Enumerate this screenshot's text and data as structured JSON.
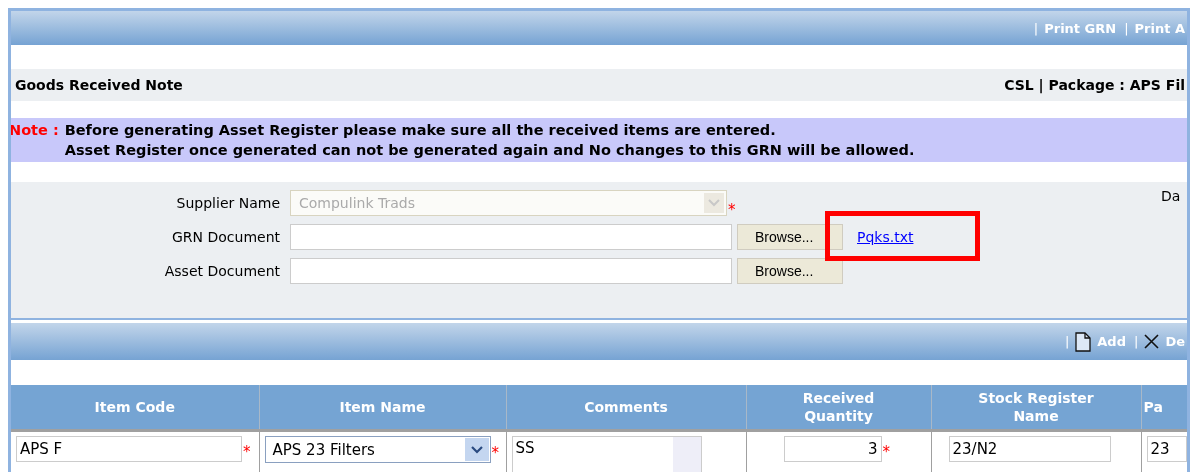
{
  "top_bar": {
    "separator": "|",
    "links": [
      "Print GRN",
      "Print A"
    ]
  },
  "title_bar": {
    "title": "Goods Received Note",
    "context": "CSL | Package : APS Fil"
  },
  "note": {
    "label": "Note :",
    "lines": [
      "Before generating Asset Register please make sure all the received items are entered.",
      "Asset Register once generated can not be generated again and No changes to this GRN will be allowed."
    ]
  },
  "form": {
    "fields": [
      {
        "kind": "select",
        "label": "Supplier Name",
        "value": "Compulink Trads",
        "disabled": true,
        "mark": "*"
      },
      {
        "kind": "file",
        "label": "GRN Document",
        "button": "Browse...",
        "link": "Pqks.txt",
        "highlighted": true
      },
      {
        "kind": "file",
        "label": "Asset Document",
        "button": "Browse..."
      }
    ],
    "side_label": "Da"
  },
  "items_bar": {
    "separator": "|",
    "actions": [
      {
        "kind": "add",
        "label": "Add"
      },
      {
        "kind": "delete",
        "label": "De"
      }
    ]
  },
  "table": {
    "columns": [
      "Item Code",
      "Item Name",
      "Comments",
      "Received Quantity",
      "Stock Register Name",
      "Pa"
    ],
    "rows": [
      [
        {
          "kind": "text",
          "value": "APS F",
          "mark": "*"
        },
        {
          "kind": "select",
          "value": "APS 23 Filters",
          "mark": "*"
        },
        {
          "kind": "textarea",
          "value": "SS"
        },
        {
          "kind": "number",
          "value": "3",
          "mark": "*"
        },
        {
          "kind": "text",
          "value": "23/N2"
        },
        {
          "kind": "text",
          "value": "23"
        }
      ]
    ]
  }
}
